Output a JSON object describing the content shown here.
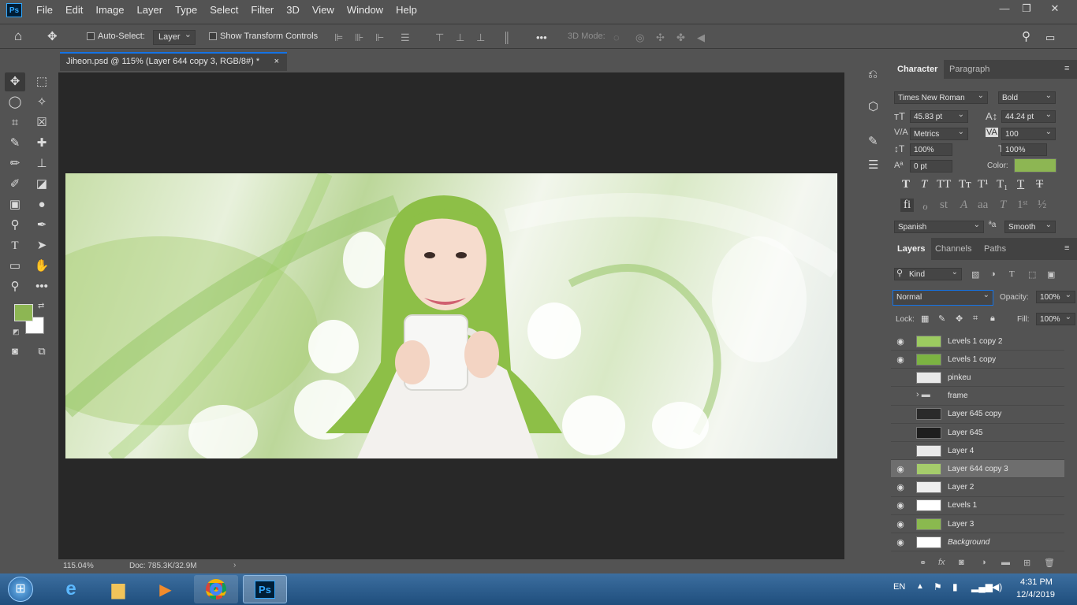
{
  "app": {
    "logo": "Ps",
    "menu": [
      "File",
      "Edit",
      "Image",
      "Layer",
      "Type",
      "Select",
      "Filter",
      "3D",
      "View",
      "Window",
      "Help"
    ],
    "window_controls": [
      "—",
      "❐",
      "✕"
    ]
  },
  "options": {
    "auto_select_label": "Auto-Select:",
    "auto_select_value": "Layer",
    "show_transform_label": "Show Transform Controls",
    "mode_3d_label": "3D Mode:"
  },
  "document": {
    "tab_title": "Jiheon.psd @ 115% (Layer 644 copy 3, RGB/8#) *",
    "close": "×",
    "zoom": "115.04%",
    "doc_info": "Doc: 785.3K/32.9M"
  },
  "character": {
    "tabs": [
      "Character",
      "Paragraph"
    ],
    "font_family": "Times New Roman",
    "font_style": "Bold",
    "font_size": "45.83 pt",
    "leading": "44.24 pt",
    "kerning": "Metrics",
    "tracking": "100",
    "vscale": "100%",
    "hscale": "100%",
    "baseline": "0 pt",
    "color_label": "Color:",
    "color": "#8db653",
    "language": "Spanish",
    "antialias": "Smooth"
  },
  "layers": {
    "tabs": [
      "Layers",
      "Channels",
      "Paths"
    ],
    "filter": "Kind",
    "blend_mode": "Normal",
    "opacity_label": "Opacity:",
    "opacity": "100%",
    "lock_label": "Lock:",
    "fill_label": "Fill:",
    "fill": "100%",
    "items": [
      {
        "name": "Levels 1 copy 2",
        "visible": true
      },
      {
        "name": "Levels 1 copy",
        "visible": true
      },
      {
        "name": "pinkeu",
        "visible": false
      },
      {
        "name": "frame",
        "visible": false
      },
      {
        "name": "Layer 645 copy",
        "visible": false
      },
      {
        "name": "Layer 645",
        "visible": false
      },
      {
        "name": "Layer 4",
        "visible": false
      },
      {
        "name": "Layer 644 copy 3",
        "visible": true
      },
      {
        "name": "Layer 2",
        "visible": true
      },
      {
        "name": "Levels 1",
        "visible": true
      },
      {
        "name": "Layer 3",
        "visible": true
      },
      {
        "name": "Background",
        "visible": true
      }
    ]
  },
  "taskbar": {
    "language": "EN",
    "time": "4:31 PM",
    "date": "12/4/2019"
  },
  "colors": {
    "foreground": "#8db653",
    "background": "#ffffff",
    "accent": "#1473e6"
  }
}
